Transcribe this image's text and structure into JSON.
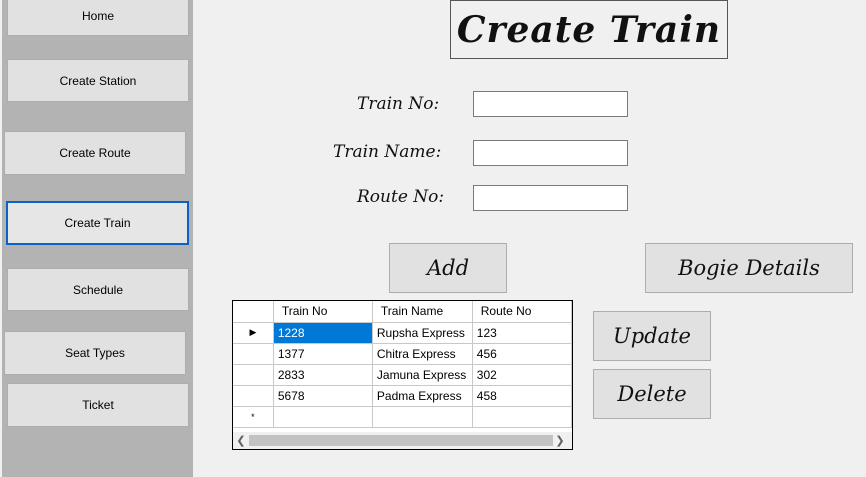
{
  "nav": {
    "home": "Home",
    "create_station": "Create Station",
    "create_route": "Create Route",
    "create_train": "Create Train",
    "schedule": "Schedule",
    "seat_types": "Seat Types",
    "ticket": "Ticket"
  },
  "form": {
    "title": "Create Train",
    "train_no_label": "Train No:",
    "train_name_label": "Train Name:",
    "route_no_label": "Route No:",
    "train_no_value": "",
    "train_name_value": "",
    "route_no_value": ""
  },
  "buttons": {
    "add": "Add",
    "bogie_details": "Bogie Details",
    "update": "Update",
    "delete": "Delete"
  },
  "grid": {
    "columns": [
      "Train No",
      "Train Name",
      "Route No"
    ],
    "rows": [
      [
        "1228",
        "Rupsha Express",
        "123"
      ],
      [
        "1377",
        "Chitra Express",
        "456"
      ],
      [
        "2833",
        "Jamuna Express",
        "302"
      ],
      [
        "5678",
        "Padma Express",
        "458"
      ]
    ],
    "current_row_marker": "▶",
    "new_row_marker": "*"
  },
  "colors": {
    "sidebar": "#b3b3b3",
    "selection": "#0078d7",
    "active_border": "#0a64c8"
  }
}
